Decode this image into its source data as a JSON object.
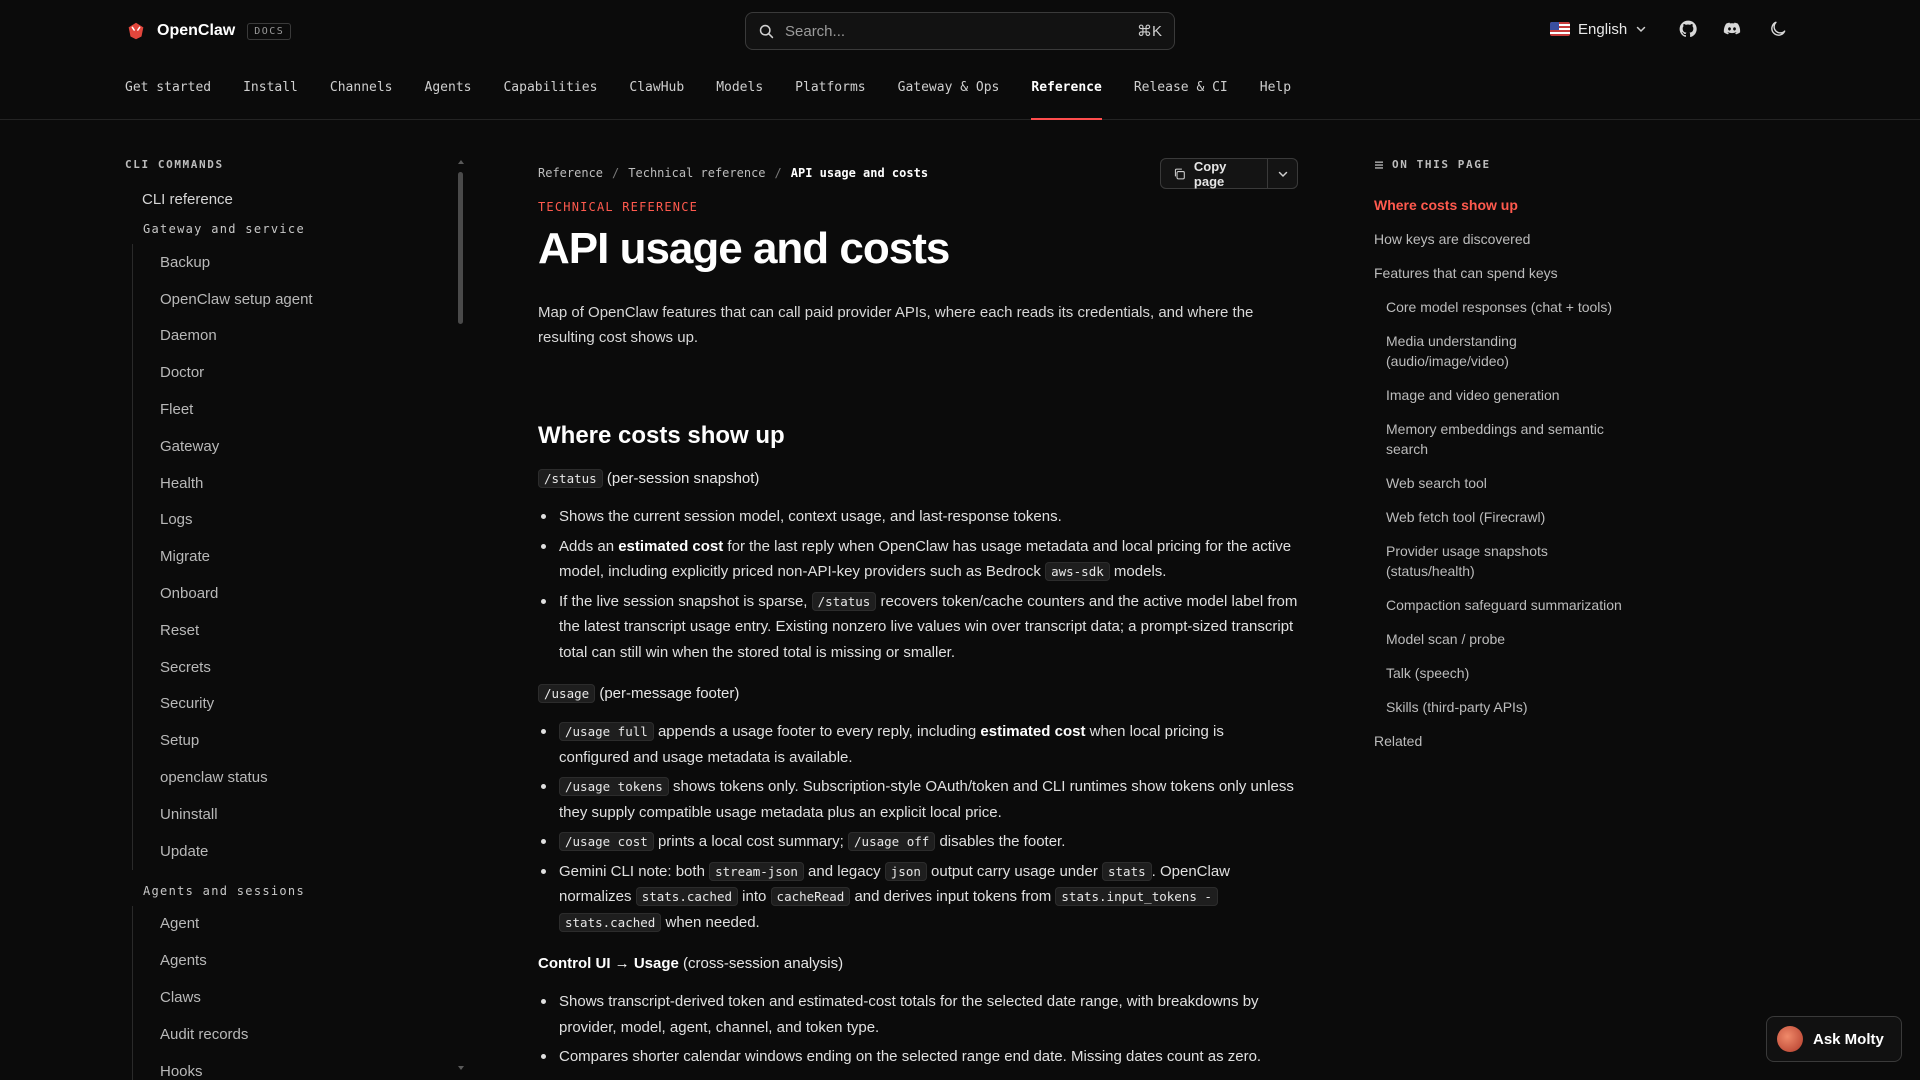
{
  "brand": {
    "name": "OpenClaw",
    "badge": "DOCS"
  },
  "search": {
    "placeholder": "Search...",
    "shortcut": "⌘K"
  },
  "language": {
    "selected": "English"
  },
  "nav": [
    {
      "label": "Get started"
    },
    {
      "label": "Install"
    },
    {
      "label": "Channels"
    },
    {
      "label": "Agents"
    },
    {
      "label": "Capabilities"
    },
    {
      "label": "ClawHub"
    },
    {
      "label": "Models"
    },
    {
      "label": "Platforms"
    },
    {
      "label": "Gateway & Ops"
    },
    {
      "label": "Reference"
    },
    {
      "label": "Release & CI"
    },
    {
      "label": "Help"
    }
  ],
  "sidebar": {
    "heading": "CLI COMMANDS",
    "top_item": "CLI reference",
    "groups": [
      {
        "title": "Gateway and service",
        "items": [
          "Backup",
          "OpenClaw setup agent",
          "Daemon",
          "Doctor",
          "Fleet",
          "Gateway",
          "Health",
          "Logs",
          "Migrate",
          "Onboard",
          "Reset",
          "Secrets",
          "Security",
          "Setup",
          "openclaw status",
          "Uninstall",
          "Update"
        ]
      },
      {
        "title": "Agents and sessions",
        "items": [
          "Agent",
          "Agents",
          "Claws",
          "Audit records",
          "Hooks"
        ]
      }
    ]
  },
  "breadcrumb": {
    "items": [
      "Reference",
      "Technical reference"
    ],
    "separator": "/",
    "current": "API usage and costs"
  },
  "copy_page": {
    "label": "Copy page"
  },
  "page": {
    "eyebrow": "TECHNICAL REFERENCE",
    "title": "API usage and costs",
    "lead": "Map of OpenClaw features that can call paid provider APIs, where each reads its credentials, and where the resulting cost shows up.",
    "section_title": "Where costs show up",
    "status": {
      "code": "/status",
      "desc": "(per-session snapshot)",
      "b1": "Shows the current session model, context usage, and last-response tokens.",
      "b2_pre": "Adds an ",
      "b2_bold": "estimated cost",
      "b2_mid": " for the last reply when OpenClaw has usage metadata and local pricing for the active model, including explicitly priced non-API-key providers such as Bedrock ",
      "b2_code": "aws-sdk",
      "b2_post": " models.",
      "b3_pre": "If the live session snapshot is sparse, ",
      "b3_code": "/status",
      "b3_post": " recovers token/cache counters and the active model label from the latest transcript usage entry. Existing nonzero live values win over transcript data; a prompt-sized transcript total can still win when the stored total is missing or smaller."
    },
    "usage": {
      "code": "/usage",
      "desc": "(per-message footer)",
      "b1_code": "/usage full",
      "b1_pre": " appends a usage footer to every reply, including ",
      "b1_bold": "estimated cost",
      "b1_post": " when local pricing is configured and usage metadata is available.",
      "b2_code": "/usage tokens",
      "b2_post": " shows tokens only. Subscription-style OAuth/token and CLI runtimes show tokens only unless they supply compatible usage metadata plus an explicit local price.",
      "b3_code1": "/usage cost",
      "b3_mid": " prints a local cost summary; ",
      "b3_code2": "/usage off",
      "b3_post": " disables the footer.",
      "b4_pre": "Gemini CLI note: both ",
      "b4_code1": "stream-json",
      "b4_t1": " and legacy ",
      "b4_code2": "json",
      "b4_t2": " output carry usage under ",
      "b4_code3": "stats",
      "b4_t3": ". OpenClaw normalizes ",
      "b4_code4": "stats.cached",
      "b4_t4": " into ",
      "b4_code5": "cacheRead",
      "b4_t5": " and derives input tokens from ",
      "b4_code6": "stats.input_tokens -",
      "b4_code7": "stats.cached",
      "b4_t6": " when needed."
    },
    "control": {
      "bold": "Control UI → Usage",
      "desc": " (cross-session analysis)",
      "b1": "Shows transcript-derived token and estimated-cost totals for the selected date range, with breakdowns by provider, model, agent, channel, and token type.",
      "b2": "Compares shorter calendar windows ending on the selected range end date. Missing dates count as zero."
    }
  },
  "toc": {
    "heading": "ON THIS PAGE",
    "items": [
      {
        "label": "Where costs show up",
        "level": 1,
        "active": true
      },
      {
        "label": "How keys are discovered",
        "level": 1
      },
      {
        "label": "Features that can spend keys",
        "level": 1
      },
      {
        "label": "Core model responses (chat + tools)",
        "level": 2
      },
      {
        "label": "Media understanding (audio/image/video)",
        "level": 2
      },
      {
        "label": "Image and video generation",
        "level": 2
      },
      {
        "label": "Memory embeddings and semantic search",
        "level": 2
      },
      {
        "label": "Web search tool",
        "level": 2
      },
      {
        "label": "Web fetch tool (Firecrawl)",
        "level": 2
      },
      {
        "label": "Provider usage snapshots (status/health)",
        "level": 2
      },
      {
        "label": "Compaction safeguard summarization",
        "level": 2
      },
      {
        "label": "Model scan / probe",
        "level": 2
      },
      {
        "label": "Talk (speech)",
        "level": 2
      },
      {
        "label": "Skills (third-party APIs)",
        "level": 2
      },
      {
        "label": "Related",
        "level": 1
      }
    ]
  },
  "ask": {
    "label": "Ask Molty"
  },
  "colors": {
    "accent": "#ff5a4e",
    "background": "#0b0b0b"
  }
}
